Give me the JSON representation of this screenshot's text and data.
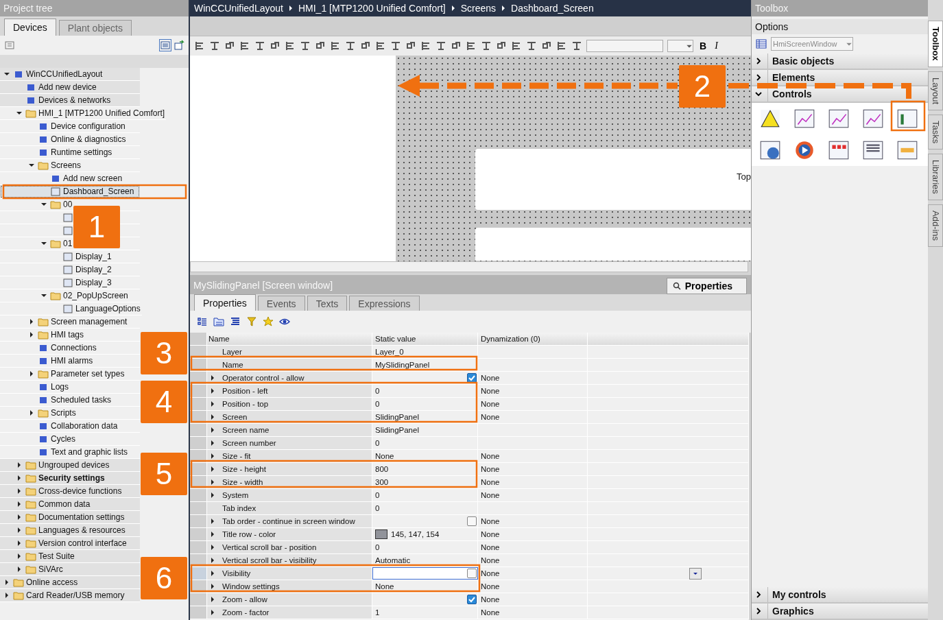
{
  "tree_panel": {
    "title": "Project tree",
    "tabs": [
      {
        "label": "Devices",
        "selected": true
      },
      {
        "label": "Plant objects",
        "selected": false
      }
    ]
  },
  "tree": [
    {
      "label": "WinCCUnifiedLayout",
      "kind": "item",
      "expanded": true,
      "selected": false,
      "children": [
        {
          "label": "Add new device",
          "kind": "item",
          "selected": false
        },
        {
          "label": "Devices & networks",
          "kind": "item",
          "selected": false
        },
        {
          "label": "HMI_1 [MTP1200 Unified Comfort]",
          "kind": "folder",
          "expanded": true,
          "selected": false,
          "children": [
            {
              "label": "Device configuration",
              "kind": "item",
              "selected": false
            },
            {
              "label": "Online & diagnostics",
              "kind": "item",
              "selected": false
            },
            {
              "label": "Runtime settings",
              "kind": "item",
              "selected": false
            },
            {
              "label": "Screens",
              "kind": "folder",
              "expanded": true,
              "selected": false,
              "children": [
                {
                  "label": "Add new screen",
                  "kind": "item",
                  "selected": false
                },
                {
                  "label": "Dashboard_Screen",
                  "kind": "screen",
                  "selected": true
                },
                {
                  "label": "00",
                  "kind": "folder",
                  "expanded": true,
                  "selected": false,
                  "children": [
                    {
                      "kind": "screen",
                      "selected": false
                    },
                    {
                      "kind": "screen",
                      "selected": false
                    }
                  ]
                },
                {
                  "label": "01",
                  "kind": "folder",
                  "expanded": true,
                  "selected": false,
                  "children": [
                    {
                      "label": "Display_1",
                      "kind": "screen",
                      "selected": false
                    },
                    {
                      "label": "Display_2",
                      "kind": "screen",
                      "selected": false
                    },
                    {
                      "label": "Display_3",
                      "kind": "screen",
                      "selected": false
                    }
                  ]
                },
                {
                  "label": "02_PopUpScreen",
                  "kind": "folder",
                  "expanded": true,
                  "selected": false,
                  "children": [
                    {
                      "label": "LanguageOptions",
                      "kind": "screen",
                      "selected": false
                    }
                  ]
                }
              ]
            },
            {
              "label": "Screen management",
              "kind": "folder",
              "expanded": false,
              "selected": false
            },
            {
              "label": "HMI tags",
              "kind": "folder",
              "expanded": false,
              "selected": false
            },
            {
              "label": "Connections",
              "kind": "item",
              "selected": false
            },
            {
              "label": "HMI alarms",
              "kind": "item",
              "selected": false
            },
            {
              "label": "Parameter set types",
              "kind": "folder",
              "expanded": false,
              "selected": false
            },
            {
              "label": "Logs",
              "kind": "item",
              "selected": false
            },
            {
              "label": "Scheduled tasks",
              "kind": "item",
              "selected": false
            },
            {
              "label": "Scripts",
              "kind": "folder",
              "expanded": false,
              "selected": false
            },
            {
              "label": "Collaboration data",
              "kind": "item",
              "selected": false
            },
            {
              "label": "Cycles",
              "kind": "item",
              "selected": false
            },
            {
              "label": "Text and graphic lists",
              "kind": "item",
              "selected": false
            }
          ]
        },
        {
          "label": "Ungrouped devices",
          "kind": "folder",
          "expanded": false,
          "selected": false
        },
        {
          "label": "Security settings",
          "kind": "folder",
          "expanded": false,
          "selected": false
        },
        {
          "label": "Cross-device functions",
          "kind": "folder",
          "expanded": false,
          "selected": false
        },
        {
          "label": "Common data",
          "kind": "folder",
          "expanded": false,
          "selected": false
        },
        {
          "label": "Documentation settings",
          "kind": "folder",
          "expanded": false,
          "selected": false
        },
        {
          "label": "Languages & resources",
          "kind": "folder",
          "expanded": false,
          "selected": false
        },
        {
          "label": "Version control interface",
          "kind": "folder",
          "expanded": false,
          "selected": false
        },
        {
          "label": "Test Suite",
          "kind": "folder",
          "expanded": false,
          "selected": false
        },
        {
          "label": "SiVArc",
          "kind": "folder",
          "expanded": false,
          "selected": false
        }
      ]
    },
    {
      "label": "Online access",
      "kind": "folder",
      "expanded": false,
      "selected": false
    },
    {
      "label": "Card Reader/USB memory",
      "kind": "folder",
      "expanded": false,
      "selected": false
    }
  ],
  "editor": {
    "breadcrumb": [
      "WinCCUnifiedLayout",
      "HMI_1 [MTP1200 Unified Comfort]",
      "Screens",
      "Dashboard_Screen"
    ],
    "bold_button": "B",
    "italic_button": "I",
    "canvas_label": "Top"
  },
  "properties": {
    "title": "MySlidingPanel [Screen window]",
    "panel_tab": {
      "label": "Properties",
      "selected": true
    },
    "tabs": [
      {
        "label": "Properties",
        "selected": true
      },
      {
        "label": "Events",
        "selected": false
      },
      {
        "label": "Texts",
        "selected": false
      },
      {
        "label": "Expressions",
        "selected": false
      }
    ],
    "columns": [
      "Name",
      "Static value",
      "Dynamization (0)"
    ],
    "rows": [
      {
        "name": "Layer",
        "kind": "text",
        "value": "Layer_0",
        "expandable": false,
        "selected": false
      },
      {
        "name": "Name",
        "kind": "text",
        "value": "MySlidingPanel",
        "expandable": false,
        "selected": false
      },
      {
        "name": "Operator control - allow",
        "kind": "checkbox",
        "checked": true,
        "dynamization": "None",
        "expandable": true,
        "selected": false
      },
      {
        "name": "Position - left",
        "kind": "text",
        "value": "0",
        "dynamization": "None",
        "expandable": true,
        "selected": false
      },
      {
        "name": "Position - top",
        "kind": "text",
        "value": "0",
        "dynamization": "None",
        "expandable": true,
        "selected": false
      },
      {
        "name": "Screen",
        "kind": "text",
        "value": "SlidingPanel",
        "dynamization": "None",
        "expandable": true,
        "selected": false
      },
      {
        "name": "Screen name",
        "kind": "text",
        "value": "SlidingPanel",
        "expandable": true,
        "selected": false
      },
      {
        "name": "Screen number",
        "kind": "text",
        "value": "0",
        "expandable": true,
        "selected": false
      },
      {
        "name": "Size - fit",
        "kind": "text",
        "value": "None",
        "dynamization": "None",
        "expandable": true,
        "selected": false
      },
      {
        "name": "Size - height",
        "kind": "text",
        "value": "800",
        "dynamization": "None",
        "expandable": true,
        "selected": false
      },
      {
        "name": "Size - width",
        "kind": "text",
        "value": "300",
        "dynamization": "None",
        "expandable": true,
        "selected": false
      },
      {
        "name": "System",
        "kind": "text",
        "value": "0",
        "dynamization": "None",
        "expandable": true,
        "selected": false
      },
      {
        "name": "Tab index",
        "kind": "text",
        "value": "0",
        "expandable": false,
        "selected": false
      },
      {
        "name": "Tab order - continue in screen window",
        "kind": "checkbox",
        "checked": false,
        "dynamization": "None",
        "expandable": true,
        "selected": false
      },
      {
        "name": "Title row - color",
        "kind": "color",
        "color": "#91939a",
        "value": "145, 147, 154",
        "dynamization": "None",
        "expandable": true,
        "selected": false
      },
      {
        "name": "Vertical scroll bar - position",
        "kind": "text",
        "value": "0",
        "dynamization": "None",
        "expandable": true,
        "selected": false
      },
      {
        "name": "Vertical scroll bar - visibility",
        "kind": "text",
        "value": "Automatic",
        "dynamization": "None",
        "expandable": true,
        "selected": false
      },
      {
        "name": "Visibility",
        "kind": "checkbox",
        "checked": false,
        "dynamization": "None",
        "expandable": true,
        "selected": true
      },
      {
        "name": "Window settings",
        "kind": "text",
        "value": "None",
        "dynamization": "None",
        "expandable": true,
        "selected": false
      },
      {
        "name": "Zoom - allow",
        "kind": "checkbox",
        "checked": true,
        "dynamization": "None",
        "expandable": true,
        "selected": false
      },
      {
        "name": "Zoom - factor",
        "kind": "text",
        "value": "1",
        "dynamization": "None",
        "expandable": true,
        "selected": false
      }
    ]
  },
  "toolbox": {
    "title": "Toolbox",
    "options_label": "Options",
    "object_type": "HmiScreenWindow",
    "sections": [
      {
        "label": "Basic objects",
        "expanded": false
      },
      {
        "label": "Elements",
        "expanded": false
      },
      {
        "label": "Controls",
        "expanded": true
      }
    ],
    "bottom_sections": [
      {
        "label": "My controls",
        "expanded": false
      },
      {
        "label": "Graphics",
        "expanded": false
      }
    ]
  },
  "side_tabs": [
    {
      "label": "Toolbox",
      "selected": true
    },
    {
      "label": "Layout",
      "selected": false
    },
    {
      "label": "Tasks",
      "selected": false
    },
    {
      "label": "Libraries",
      "selected": false
    },
    {
      "label": "Add-ins",
      "selected": false
    }
  ],
  "callouts": [
    "1",
    "2",
    "3",
    "4",
    "5",
    "6"
  ]
}
